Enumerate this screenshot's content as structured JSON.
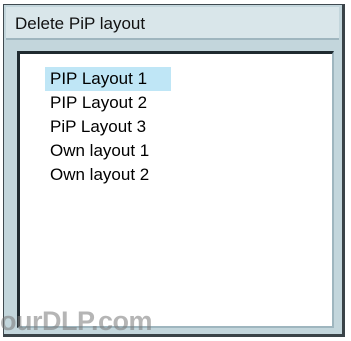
{
  "dialog": {
    "title": "Delete PiP layout"
  },
  "layouts": [
    {
      "label": "PIP Layout 1",
      "selected": true
    },
    {
      "label": "PIP Layout 2",
      "selected": false
    },
    {
      "label": "PiP Layout 3",
      "selected": false
    },
    {
      "label": "Own layout 1",
      "selected": false
    },
    {
      "label": "Own layout 2",
      "selected": false
    }
  ],
  "watermark": "ourDLP.com",
  "colors": {
    "selection": "#bfe6f6",
    "frame": "#c3d6dc",
    "titlebar": "#d9e6ea"
  }
}
